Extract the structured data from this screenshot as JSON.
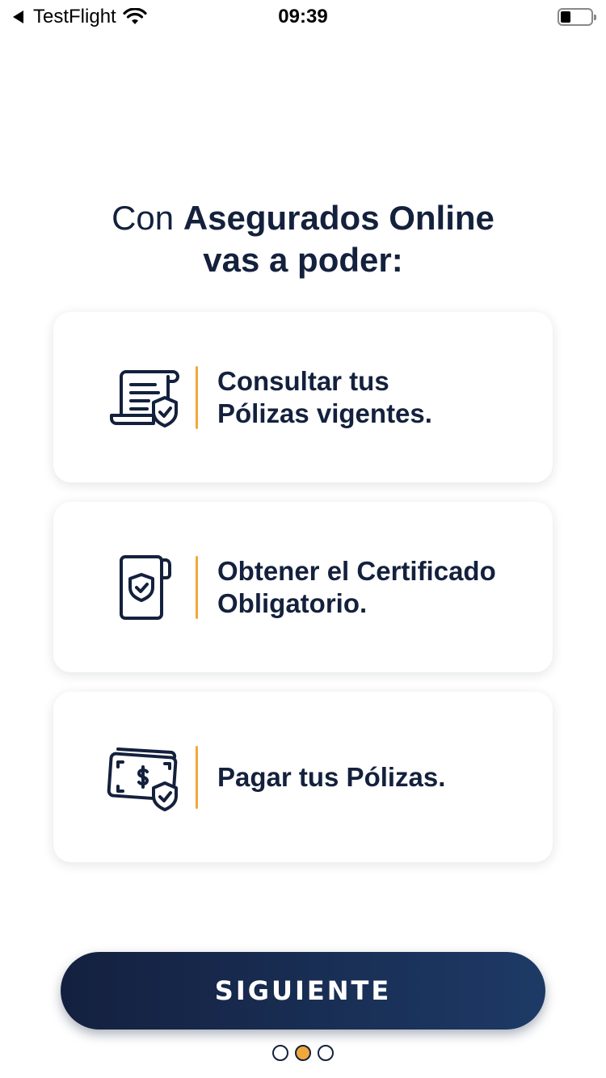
{
  "status_bar": {
    "back_app": "TestFlight",
    "time": "09:39"
  },
  "heading": {
    "prefix": "Con",
    "app_name": "Asegurados Online",
    "line2": "vas a poder:"
  },
  "cards": [
    {
      "icon": "policy-document-shield-icon",
      "line1": "Consultar tus",
      "line2": "Pólizas vigentes."
    },
    {
      "icon": "certificate-shield-icon",
      "line1": "Obtener el Certificado",
      "line2": "Obligatorio."
    },
    {
      "icon": "money-shield-icon",
      "line1": "Pagar tus Pólizas.",
      "line2": ""
    }
  ],
  "button": {
    "label": "SIGUIENTE"
  },
  "pager": {
    "count": 3,
    "active_index": 1
  },
  "colors": {
    "primary": "#14213d",
    "accent": "#f1a83a"
  }
}
